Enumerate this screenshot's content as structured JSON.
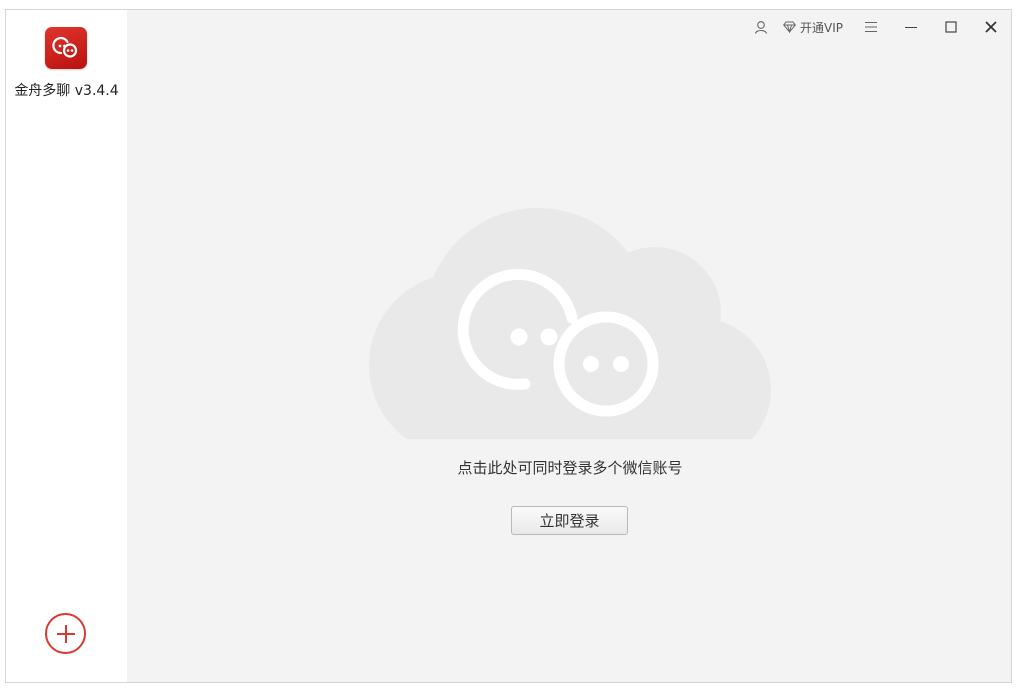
{
  "app": {
    "name": "金舟多聊 v3.4.4",
    "accent_color": "#d83a32"
  },
  "titlebar": {
    "vip_label": "开通VIP",
    "icons": [
      "user-icon",
      "diamond-icon",
      "menu-icon",
      "minimize-icon",
      "maximize-icon",
      "close-icon"
    ]
  },
  "main": {
    "prompt": "点击此处可同时登录多个微信账号",
    "login_button": "立即登录"
  }
}
